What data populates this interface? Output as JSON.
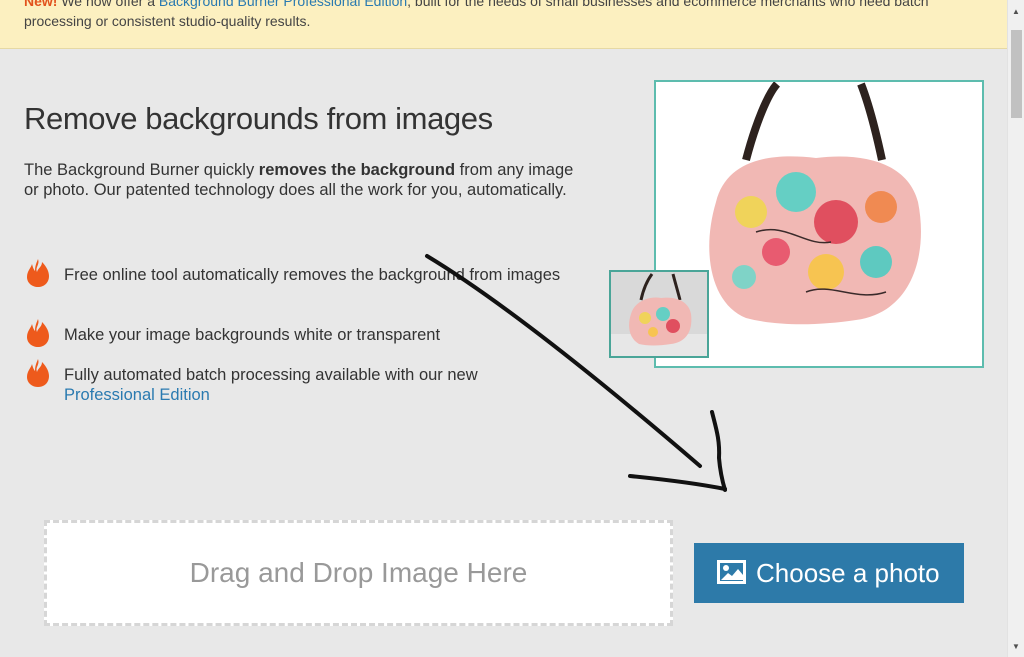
{
  "banner": {
    "new_label": "New!",
    "text_before_link": " We now offer a ",
    "link_text": "Background Burner Professional Edition",
    "text_after_link": ", built for the needs of small businesses and ecommerce merchants who need batch processing or consistent studio-quality results."
  },
  "main": {
    "heading": "Remove backgrounds from images",
    "intro_before": "The Background Burner quickly ",
    "intro_bold": "removes the background",
    "intro_after": " from any image or photo. Our patented technology does all the work for you, automatically."
  },
  "features": [
    {
      "text": "Free online tool automatically removes the background from images"
    },
    {
      "text": "Make your image backgrounds white or transparent"
    },
    {
      "text": "Fully automated batch processing available with our new ",
      "link": "Professional Edition"
    }
  ],
  "upload": {
    "dropzone_label": "Drag and Drop Image Here",
    "button_label": "Choose a photo"
  },
  "icons": {
    "feature_bullet": "flame-icon",
    "upload_button": "image-icon"
  },
  "colors": {
    "banner_bg": "#fcf0c0",
    "accent_link": "#2a7ab0",
    "button_bg": "#2d7aa9",
    "flame": "#ee5a1c",
    "photo_border": "#5dbcae"
  }
}
